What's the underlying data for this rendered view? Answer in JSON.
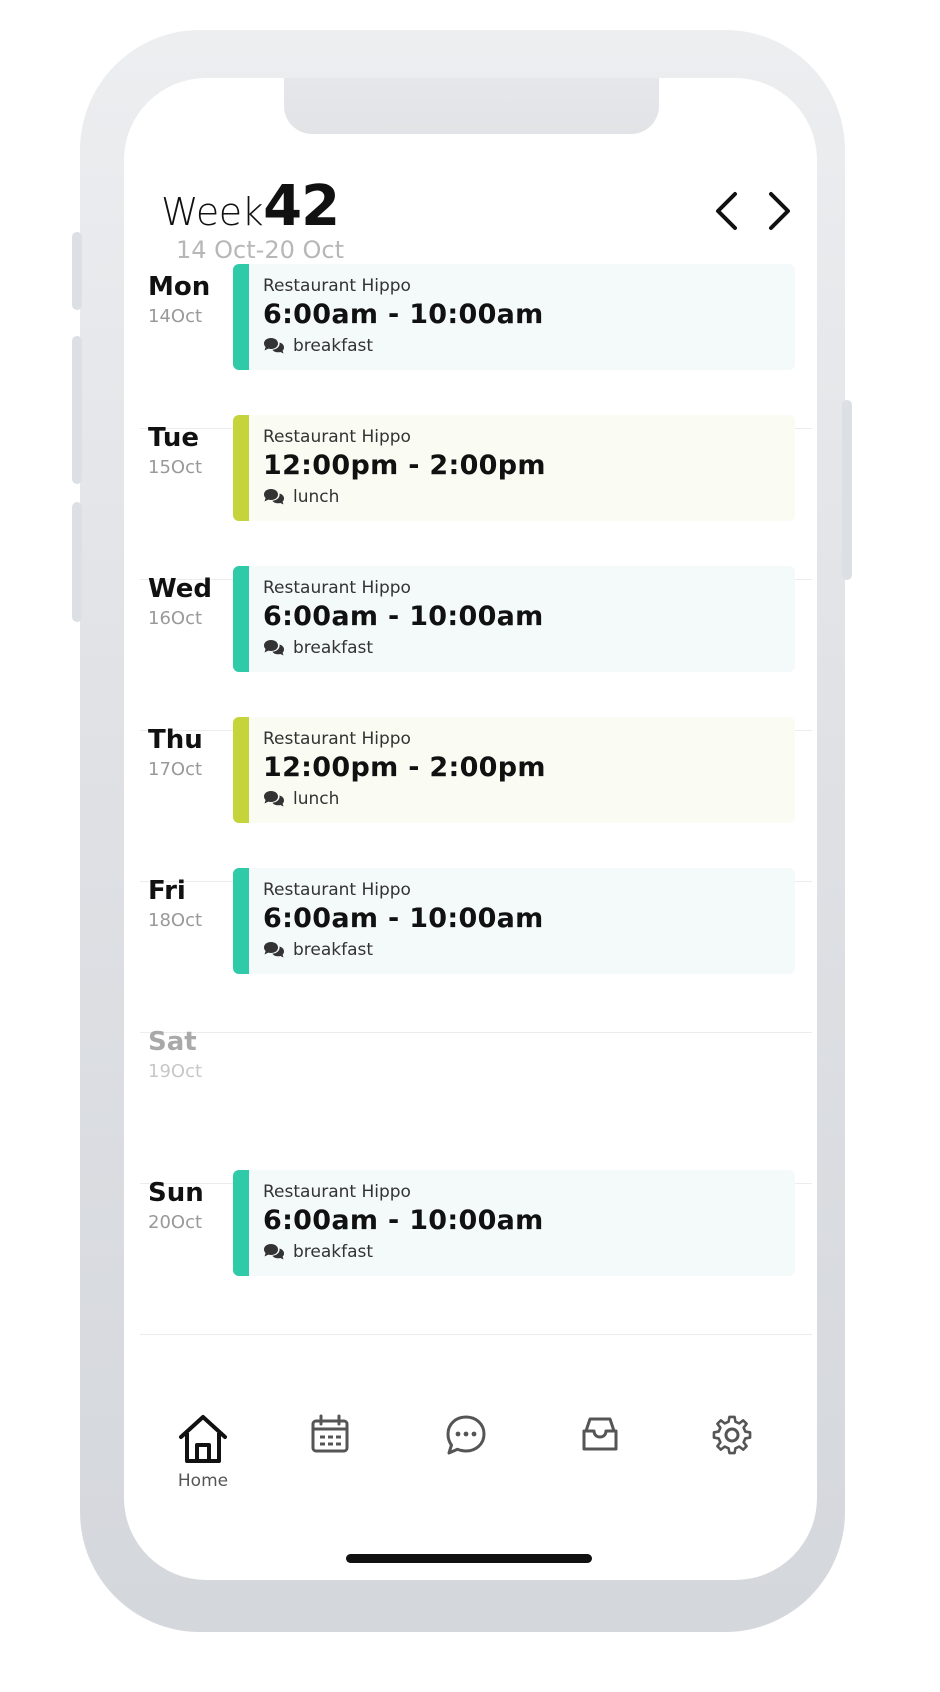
{
  "header": {
    "week_label": "Week",
    "week_number": "42",
    "date_range": "14 Oct-20 Oct",
    "prev_icon": "chevron-left-icon",
    "next_icon": "chevron-right-icon"
  },
  "colors": {
    "breakfast_accent": "#2fcaa8",
    "breakfast_bg": "#f3faf9",
    "lunch_accent": "#c5d43b",
    "lunch_bg": "#fafbf3",
    "text_primary": "#111111",
    "text_muted": "#999999"
  },
  "days": [
    {
      "name": "Mon",
      "date": "14Oct",
      "shift": {
        "restaurant": "Restaurant Hippo",
        "time": "6:00am - 10:00am",
        "note": "breakfast",
        "type": "breakfast"
      }
    },
    {
      "name": "Tue",
      "date": "15Oct",
      "shift": {
        "restaurant": "Restaurant Hippo",
        "time": "12:00pm - 2:00pm",
        "note": "lunch",
        "type": "lunch"
      }
    },
    {
      "name": "Wed",
      "date": "16Oct",
      "shift": {
        "restaurant": "Restaurant Hippo",
        "time": "6:00am - 10:00am",
        "note": "breakfast",
        "type": "breakfast"
      }
    },
    {
      "name": "Thu",
      "date": "17Oct",
      "shift": {
        "restaurant": "Restaurant Hippo",
        "time": "12:00pm - 2:00pm",
        "note": "lunch",
        "type": "lunch"
      }
    },
    {
      "name": "Fri",
      "date": "18Oct",
      "shift": {
        "restaurant": "Restaurant Hippo",
        "time": "6:00am - 10:00am",
        "note": "breakfast",
        "type": "breakfast"
      }
    },
    {
      "name": "Sat",
      "date": "19Oct",
      "shift": null
    },
    {
      "name": "Sun",
      "date": "20Oct",
      "shift": {
        "restaurant": "Restaurant Hippo",
        "time": "6:00am - 10:00am",
        "note": "breakfast",
        "type": "breakfast"
      }
    }
  ],
  "tabs": [
    {
      "id": "home",
      "label": "Home",
      "icon": "home-icon",
      "active": true
    },
    {
      "id": "calendar",
      "label": "",
      "icon": "calendar-icon",
      "active": false
    },
    {
      "id": "messages",
      "label": "",
      "icon": "chat-icon",
      "active": false
    },
    {
      "id": "inbox",
      "label": "",
      "icon": "inbox-icon",
      "active": false
    },
    {
      "id": "settings",
      "label": "",
      "icon": "gear-icon",
      "active": false
    }
  ]
}
